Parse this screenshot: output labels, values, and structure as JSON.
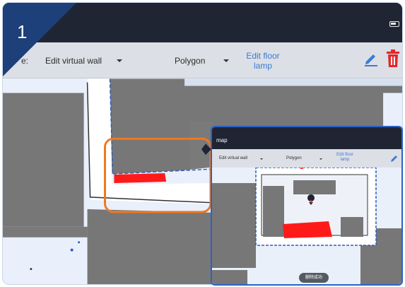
{
  "step_badge": {
    "number": "1"
  },
  "toolbar": {
    "prefix_label": "e:",
    "wall_mode": "Edit virtual wall",
    "shape": "Polygon",
    "edit_link": [
      "Edit floor",
      "lamp"
    ]
  },
  "inset": {
    "title": "map",
    "toolbar": {
      "wall_mode": "Edit virtual wall",
      "shape": "Polygon",
      "edit_link": [
        "Edit floor",
        "lamp"
      ]
    },
    "toast": "删除成功"
  },
  "colors": {
    "top_bar": "#1f2533",
    "toolbar": "#dcdfe5",
    "map_background": "#e9f0fb",
    "obstacle": "#777777",
    "wall_path": "#ffffff",
    "no_go_zone": "#ff1a1a",
    "highlight": "#f07820",
    "badge": "#1d3f7a",
    "inset_border": "#2b62c6",
    "link": "#3a7bd5",
    "delete_icon": "#e0282a",
    "edit_icon": "#3a7bd5"
  },
  "icons": [
    "pencil-icon",
    "trash-icon",
    "location-pin-icon",
    "battery-icon",
    "dropdown-caret-icon"
  ]
}
